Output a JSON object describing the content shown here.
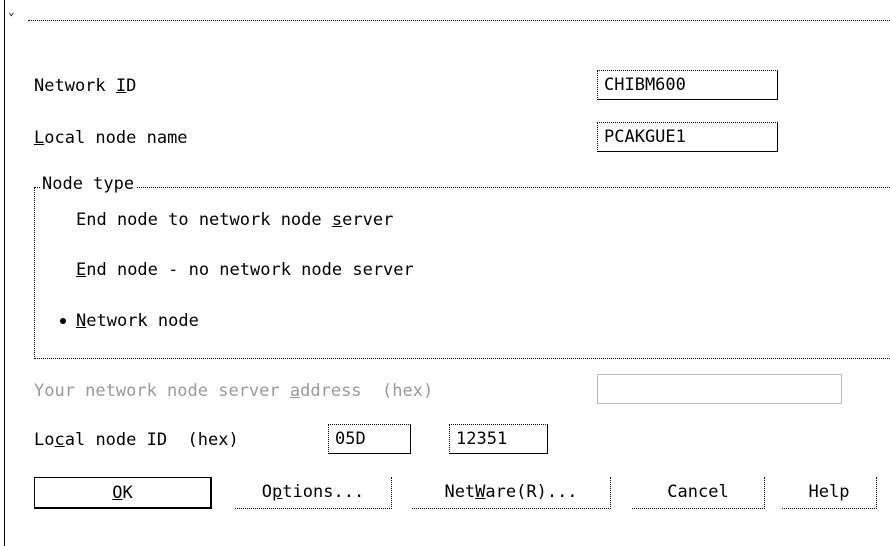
{
  "window": {
    "system_menu_glyph": "⌄"
  },
  "network_id": {
    "label_pre": "Network ",
    "label_mn": "I",
    "label_post": "D",
    "value": "CHIBM600"
  },
  "local_node_name": {
    "label_pre": "",
    "label_mn": "L",
    "label_post": "ocal node name",
    "value": "PCAKGUE1"
  },
  "node_type": {
    "title": "Node type",
    "options": [
      {
        "pre": "End node to network node ",
        "mn": "s",
        "post": "erver",
        "selected": false
      },
      {
        "pre": "",
        "mn": "E",
        "post": "nd node - no network node server",
        "selected": false
      },
      {
        "pre": "",
        "mn": "N",
        "post": "etwork node",
        "selected": true
      }
    ]
  },
  "server_address": {
    "label_pre": "Your network node server ",
    "label_mn": "a",
    "label_post": "ddress  (hex)",
    "value": "",
    "enabled": false
  },
  "local_node_id": {
    "label_pre": "Lo",
    "label_mn": "c",
    "label_post": "al node ID  (hex)",
    "block_id": "05D",
    "pu_id": "12351"
  },
  "buttons": {
    "ok": {
      "pre": "",
      "mn": "O",
      "post": "K"
    },
    "options": {
      "pre": "O",
      "mn": "p",
      "post": "tions..."
    },
    "netware": {
      "pre": "Net",
      "mn": "W",
      "post": "are(R)..."
    },
    "cancel": {
      "label": "Cancel"
    },
    "help": {
      "label": "Help"
    }
  }
}
